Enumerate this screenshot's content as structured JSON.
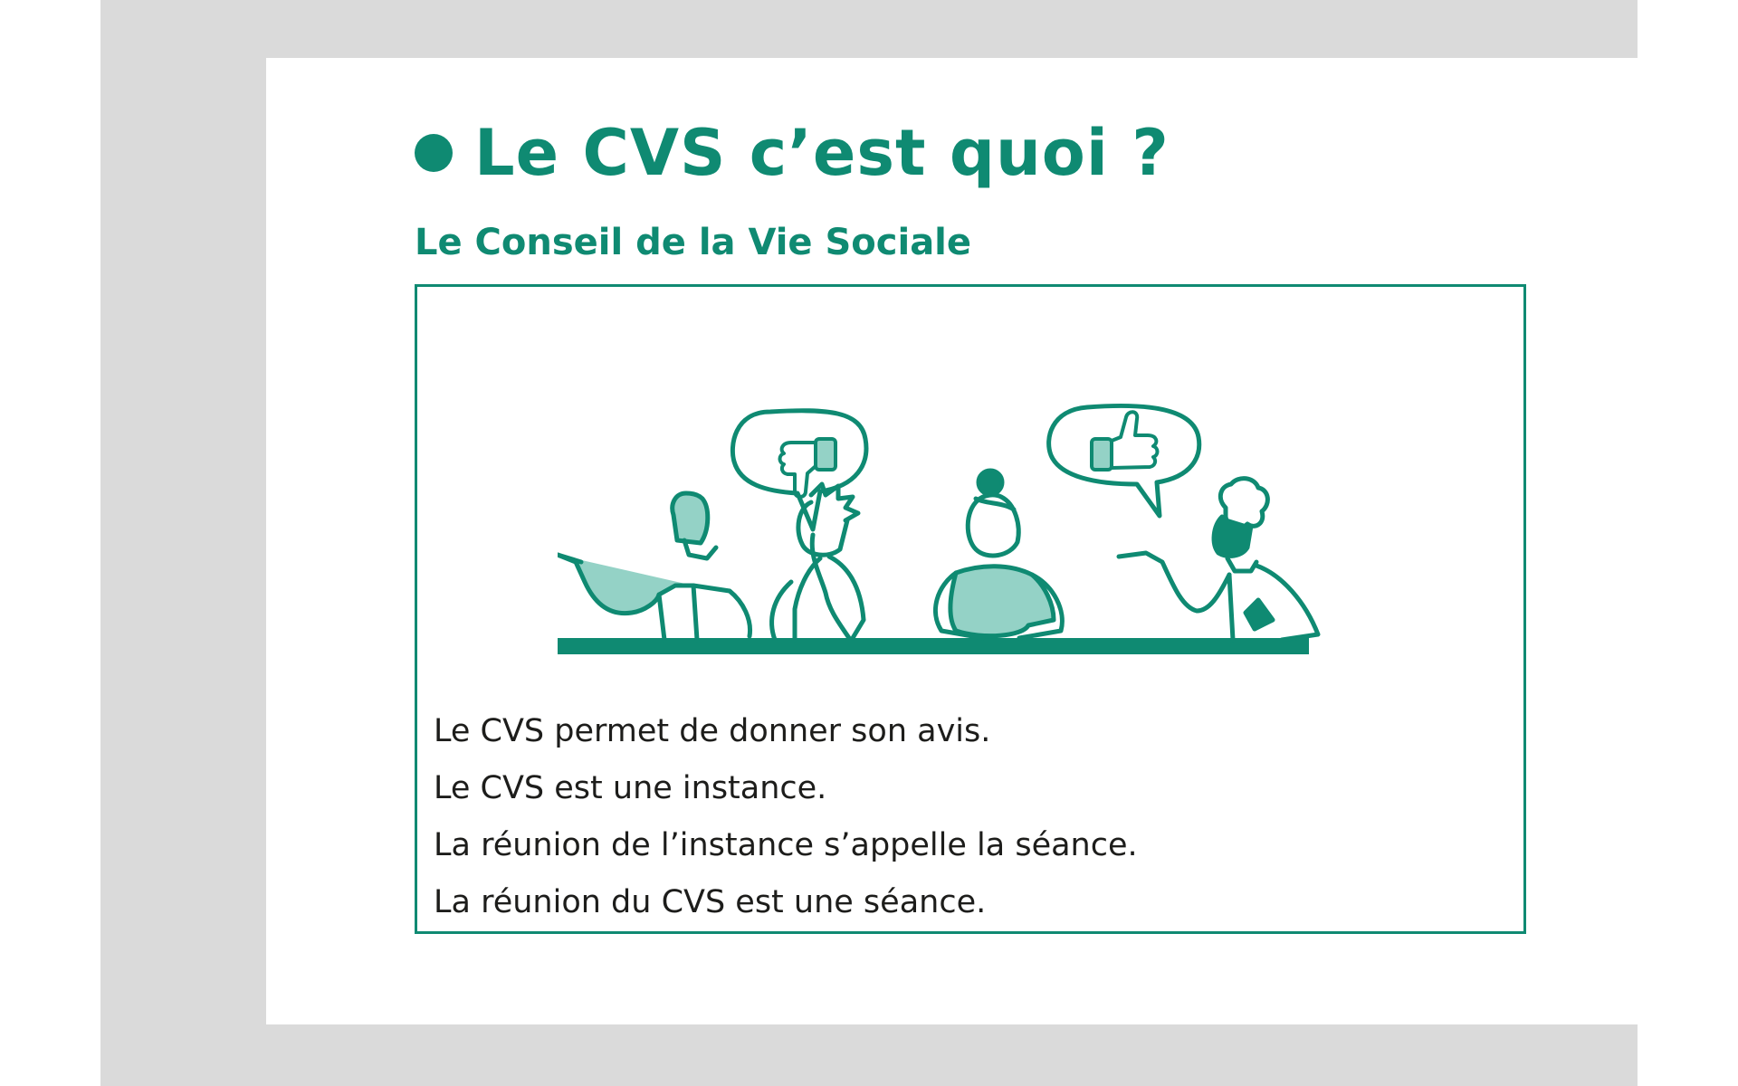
{
  "colors": {
    "accent": "#0f8a72",
    "accent_light": "#94d2c6",
    "text": "#1d1d1b",
    "frame": "#dadada"
  },
  "header": {
    "title": "Le CVS c’est quoi ?",
    "subtitle": "Le Conseil de la Vie Sociale"
  },
  "illustration": {
    "icons": [
      "thumbs-down-icon",
      "thumbs-up-icon"
    ]
  },
  "body": {
    "lines": [
      "Le CVS permet de donner son avis.",
      "Le CVS est une instance.",
      "La réunion de l’instance s’appelle la séance.",
      "La réunion du CVS est une séance."
    ]
  }
}
